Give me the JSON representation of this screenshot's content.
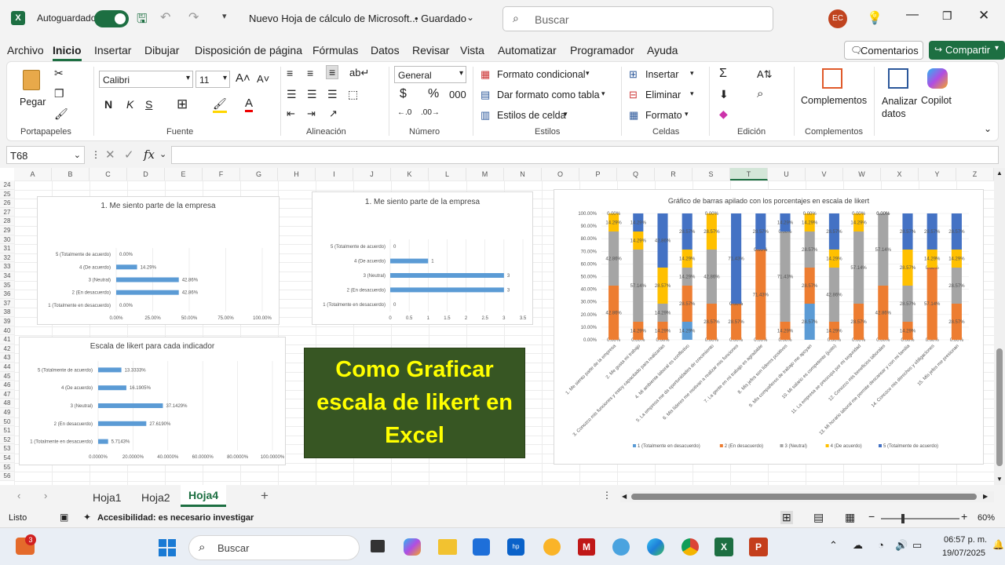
{
  "titlebar": {
    "autosave_label": "Autoguardado",
    "doc_title": "Nuevo Hoja de cálculo de Microsoft...",
    "saved_status": "• Guardado",
    "search_placeholder": "Buscar",
    "user_initials": "EC"
  },
  "menu": [
    "Archivo",
    "Inicio",
    "Insertar",
    "Dibujar",
    "Disposición de página",
    "Fórmulas",
    "Datos",
    "Revisar",
    "Vista",
    "Automatizar",
    "Programador",
    "Ayuda"
  ],
  "menu_active": "Inicio",
  "menu_right": {
    "comments": "Comentarios",
    "share": "Compartir"
  },
  "ribbon": {
    "paste": "Pegar",
    "clipboard_group": "Portapapeles",
    "font_name": "Calibri",
    "font_size": "11",
    "font_group": "Fuente",
    "alignment_group": "Alineación",
    "number_format": "General",
    "number_group": "Número",
    "cond_format": "Formato condicional",
    "table_format": "Dar formato como tabla",
    "cell_styles": "Estilos de celda",
    "styles_group": "Estilos",
    "insert": "Insertar",
    "delete": "Eliminar",
    "format": "Formato",
    "cells_group": "Celdas",
    "edit_group": "Edición",
    "addins": "Complementos",
    "addins_group": "Complementos",
    "analyze": "Analizar datos",
    "copilot": "Copilot"
  },
  "formula_bar": {
    "namebox": "T68",
    "fx": "fx",
    "value": ""
  },
  "columns": [
    "A",
    "B",
    "C",
    "D",
    "E",
    "F",
    "G",
    "H",
    "I",
    "J",
    "K",
    "L",
    "M",
    "N",
    "O",
    "P",
    "Q",
    "R",
    "S",
    "T",
    "U",
    "V",
    "W",
    "X",
    "Y",
    "Z"
  ],
  "rows": [
    "24",
    "25",
    "26",
    "27",
    "28",
    "29",
    "30",
    "31",
    "32",
    "33",
    "34",
    "35",
    "36",
    "37",
    "38",
    "39",
    "40",
    "41",
    "42",
    "43",
    "44",
    "45",
    "46",
    "47",
    "48",
    "49",
    "50",
    "51",
    "52",
    "53",
    "54",
    "55",
    "56"
  ],
  "overlay_text": [
    "Como Graficar",
    "escala de likert en",
    "Excel"
  ],
  "chart_data": [
    {
      "type": "bar",
      "title": "1. Me siento parte de la empresa",
      "categories": [
        "5 (Totalmente de acuerdo)",
        "4 (De acuerdo)",
        "3 (Neutral)",
        "2 (En desacuerdo)",
        "1 (Totalmente en desacuerdo)"
      ],
      "values": [
        0,
        14.29,
        42.86,
        42.86,
        0
      ],
      "labels": [
        "0.00%",
        "14.29%",
        "42.86%",
        "42.86%",
        "0.00%"
      ],
      "xlim": [
        0,
        100
      ],
      "ticks": [
        "0.00%",
        "25.00%",
        "50.00%",
        "75.00%",
        "100.00%"
      ]
    },
    {
      "type": "bar",
      "title": "1. Me siento parte de la empresa",
      "categories": [
        "5 (Totalmente de acuerdo)",
        "4 (De acuerdo)",
        "3 (Neutral)",
        "2 (En desacuerdo)",
        "1 (Totalmente en desacuerdo)"
      ],
      "values": [
        0,
        1,
        3,
        3,
        0
      ],
      "labels": [
        "0",
        "1",
        "3",
        "3",
        "0"
      ],
      "xlim": [
        0,
        3.5
      ],
      "ticks": [
        "0",
        "0.5",
        "1",
        "1.5",
        "2",
        "2.5",
        "3",
        "3.5"
      ]
    },
    {
      "type": "bar",
      "title": "Escala de likert para cada indicador",
      "categories": [
        "5 (Totalmente de acuerdo)",
        "4 (De acuerdo)",
        "3 (Neutral)",
        "2 (En desacuerdo)",
        "1 (Totalmente en desacuerdo)"
      ],
      "values": [
        13.3333,
        16.1905,
        37.1429,
        27.619,
        5.7143
      ],
      "labels": [
        "13.3333%",
        "16.1905%",
        "37.1429%",
        "27.6190%",
        "5.7143%"
      ],
      "xlim": [
        0,
        100
      ],
      "ticks": [
        "0.0000%",
        "20.0000%",
        "40.0000%",
        "60.0000%",
        "80.0000%",
        "100.0000%"
      ]
    },
    {
      "type": "bar",
      "stacked": true,
      "title": "Gráfico de barras apilado con los porcentajes en escala de likert",
      "ylim": [
        0,
        100
      ],
      "yticks": [
        "0.00%",
        "10.00%",
        "20.00%",
        "30.00%",
        "40.00%",
        "50.00%",
        "60.00%",
        "70.00%",
        "80.00%",
        "90.00%",
        "100.00%"
      ],
      "categories": [
        "1. Me siento parte de la empresa",
        "2. Me gusta mi trabajo",
        "3. Conozco mis funciones y estoy capacitado para realizarlas",
        "4. Mi ambiente laboral es conflictivo",
        "5. La empresa me da oportunidades de crecimiento",
        "6. Mis líderes me motivan a realizar mis funciones",
        "7. La gente en mi trabajo es agradable",
        "8. Mis jefes son líderes positivos",
        "9. Mis compañeros de trabajo me apoyan",
        "10. Mi salario es competente (justo)",
        "11. La empresa se preocupa por mi seguridad",
        "12. Conozco mis beneficios laborales",
        "13. Mi horario laboral me permite descansar y con mi familia",
        "14. Conozco mis derechos y obligaciones",
        "15. Mis jefes me presionan"
      ],
      "series": [
        {
          "name": "1 (Totalmente en desacuerdo)",
          "color": "#5b9bd5",
          "values": [
            0,
            0,
            0,
            14.29,
            0,
            0,
            0,
            0,
            28.57,
            0,
            0,
            0,
            0,
            0,
            0
          ]
        },
        {
          "name": "2 (En desacuerdo)",
          "color": "#ed7d31",
          "values": [
            42.86,
            14.29,
            14.29,
            28.57,
            28.57,
            28.57,
            71.43,
            14.29,
            28.57,
            14.29,
            28.57,
            42.86,
            14.29,
            57.14,
            28.57
          ]
        },
        {
          "name": "3 (Neutral)",
          "color": "#a5a5a5",
          "values": [
            42.86,
            57.14,
            14.29,
            14.29,
            42.86,
            0,
            0,
            71.43,
            28.57,
            42.86,
            57.14,
            57.14,
            28.57,
            0,
            28.57
          ]
        },
        {
          "name": "4 (De acuerdo)",
          "color": "#ffc000",
          "values": [
            14.29,
            14.29,
            28.57,
            14.29,
            28.57,
            0,
            0,
            0,
            14.29,
            14.29,
            14.29,
            0,
            28.57,
            14.29,
            14.29
          ]
        },
        {
          "name": "5 (Totalmente de acuerdo)",
          "color": "#4472c4",
          "values": [
            0,
            14.29,
            42.86,
            28.57,
            0,
            71.43,
            28.57,
            14.29,
            0,
            28.57,
            0,
            0,
            28.57,
            28.57,
            28.57
          ]
        }
      ]
    }
  ],
  "sheet_tabs": [
    "Hoja1",
    "Hoja2",
    "Hoja4"
  ],
  "active_tab": "Hoja4",
  "status": {
    "ready": "Listo",
    "accessibility": "Accesibilidad: es necesario investigar",
    "zoom": "60%"
  },
  "taskbar": {
    "search": "Buscar",
    "time": "06:57 p. m.",
    "date": "19/07/2025",
    "badge": "3"
  }
}
